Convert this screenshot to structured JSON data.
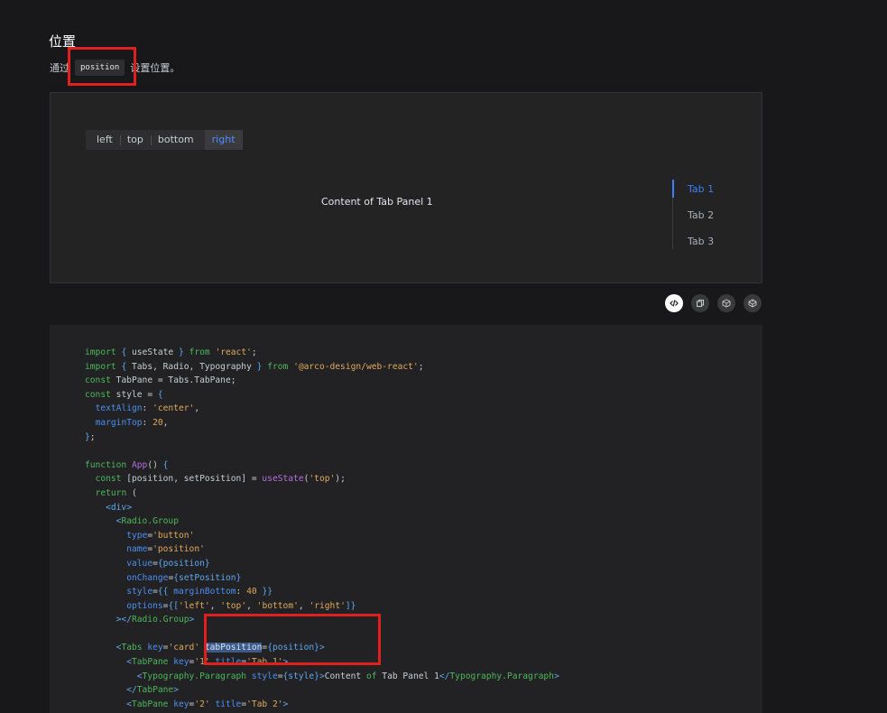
{
  "section": {
    "title": "位置",
    "desc_prefix": "通过",
    "desc_code": "position",
    "desc_suffix": "设置位置。"
  },
  "demo": {
    "radio_options": [
      "left",
      "top",
      "bottom",
      "right"
    ],
    "radio_selected": "right",
    "tab_content": "Content of Tab Panel 1",
    "tabs": [
      "Tab 1",
      "Tab 2",
      "Tab 3"
    ],
    "active_tab": "Tab 1"
  },
  "toolbar": {
    "icons": [
      "code-toggle-icon",
      "copy-icon",
      "codesandbox-icon",
      "codepen-icon"
    ]
  },
  "colors": {
    "accent": "#3c7eff",
    "highlight_box": "#e0201c"
  },
  "code": {
    "lines": [
      "import { useState } from 'react';",
      "import { Tabs, Radio, Typography } from '@arco-design/web-react';",
      "const TabPane = Tabs.TabPane;",
      "const style = {",
      "  textAlign: 'center',",
      "  marginTop: 20,",
      "};",
      "",
      "function App() {",
      "  const [position, setPosition] = useState('top');",
      "  return (",
      "    <div>",
      "      <Radio.Group",
      "        type='button'",
      "        name='position'",
      "        value={position}",
      "        onChange={setPosition}",
      "        style={{ marginBottom: 40 }}",
      "        options={['left', 'top', 'bottom', 'right']}",
      "      ></Radio.Group>",
      "",
      "      <Tabs key='card' tabPosition={position}>",
      "        <TabPane key='1' title='Tab 1'>",
      "          <Typography.Paragraph style={style}>Content of Tab Panel 1</Typography.Paragraph>",
      "        </TabPane>",
      "        <TabPane key='2' title='Tab 2'>"
    ]
  }
}
